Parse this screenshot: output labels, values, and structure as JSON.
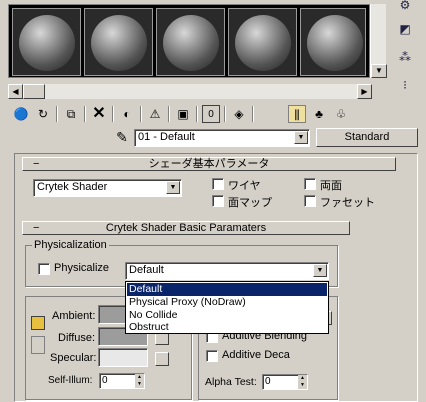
{
  "material_editor": {
    "slot_count": 5,
    "toolbar": {
      "material_name": "01 - Default",
      "type_button": "Standard"
    },
    "shader_basic": {
      "title": "シェーダ基本パラメータ",
      "shader_type": "Crytek Shader",
      "checkboxes": {
        "wire": "ワイヤ",
        "two_sided": "両面",
        "face_map": "面マップ",
        "faceted": "ファセット"
      }
    },
    "crytek_basic": {
      "title": "Crytek Shader Basic Paramaters",
      "physicalization": {
        "group_title": "Physicalization",
        "checkbox_label": "Physicalize",
        "selected": "Default",
        "options": [
          "Default",
          "Physical Proxy (NoDraw)",
          "No Collide",
          "Obstruct"
        ]
      },
      "color_labels": {
        "ambient": "Ambient:",
        "diffuse": "Diffuse:",
        "specular": "Specular:",
        "self_illum": "Self-Illum:"
      },
      "self_illum_value": "0",
      "right_options": {
        "additive_blending": "Additive Blending",
        "additive_decal": "Additive Deca"
      },
      "alpha_test_label": "Alpha Test:",
      "alpha_test_value": "0"
    }
  }
}
